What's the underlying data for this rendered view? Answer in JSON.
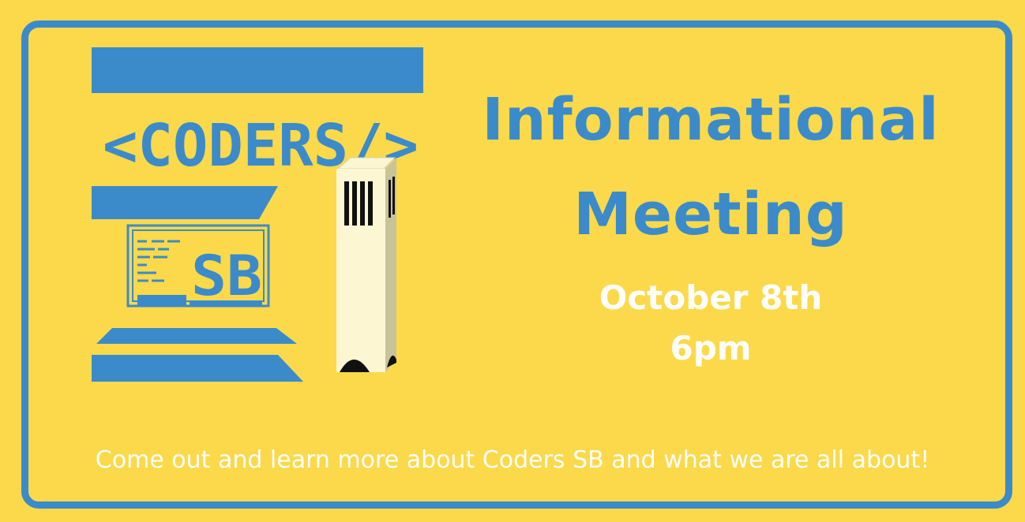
{
  "logo": {
    "wordmark": "<CODERS/>",
    "sub_mark": "SB",
    "colors": {
      "primary": "#3b8bca",
      "background": "#fcd94a",
      "tower": "#fdf6d2"
    }
  },
  "event": {
    "title_line1": "Informational",
    "title_line2": "Meeting",
    "date": "October 8th",
    "time": "6pm",
    "description": "Come out and learn more about Coders SB and what we are all about!"
  }
}
